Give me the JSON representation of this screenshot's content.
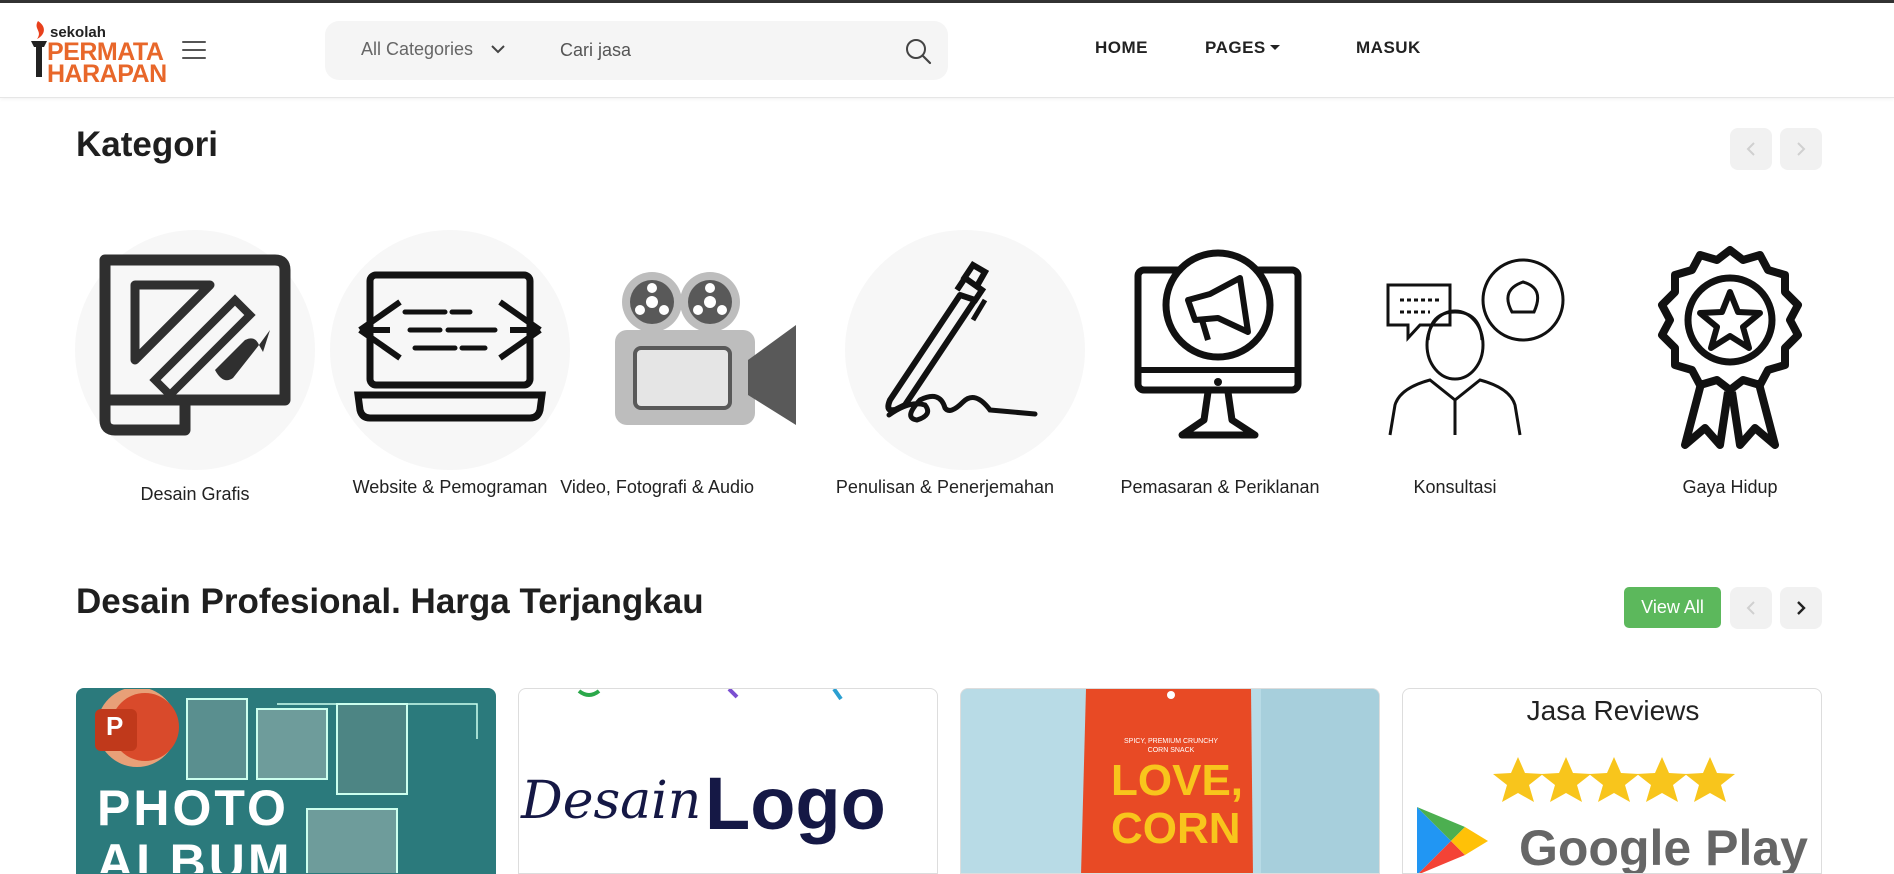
{
  "header": {
    "logo": {
      "small": "sekolah",
      "line1": "PERMATA",
      "line2": "HARAPAN"
    },
    "search": {
      "category": "All Categories",
      "placeholder": "Cari jasa"
    },
    "nav": {
      "home": "HOME",
      "pages": "PAGES",
      "masuk": "MASUK"
    }
  },
  "categories": {
    "title": "Kategori",
    "items": [
      {
        "label": "Desain Grafis",
        "icon": "graphic-design-icon"
      },
      {
        "label": "Website & Pemograman",
        "icon": "laptop-code-icon"
      },
      {
        "label": "Video, Fotografi & Audio",
        "icon": "video-camera-icon"
      },
      {
        "label": "Penulisan & Penerjemahan",
        "icon": "pen-icon"
      },
      {
        "label": "Pemasaran & Periklanan",
        "icon": "monitor-megaphone-icon"
      },
      {
        "label": "Konsultasi",
        "icon": "consultant-icon"
      },
      {
        "label": "Gaya Hidup",
        "icon": "award-ribbon-icon"
      }
    ]
  },
  "featured": {
    "title": "Desain Profesional. Harga Terjangkau",
    "view_all": "View All",
    "cards": [
      {
        "lines": [
          "PHOTO",
          "ALBUM"
        ],
        "badge": "P"
      },
      {
        "script": "Desain",
        "bold": "Logo"
      },
      {
        "headline": "LOVE, CORN",
        "tagline": "SPICY, PREMIUM CRUNCHY CORN SNACK"
      },
      {
        "title": "Jasa Reviews",
        "store": "Google Play"
      }
    ]
  },
  "colors": {
    "brand_orange": "#e8672a",
    "view_all_green": "#5cb85c",
    "teal_card": "#2b7a7c",
    "red_card": "#e84a25",
    "star_yellow": "#f8c51c"
  }
}
